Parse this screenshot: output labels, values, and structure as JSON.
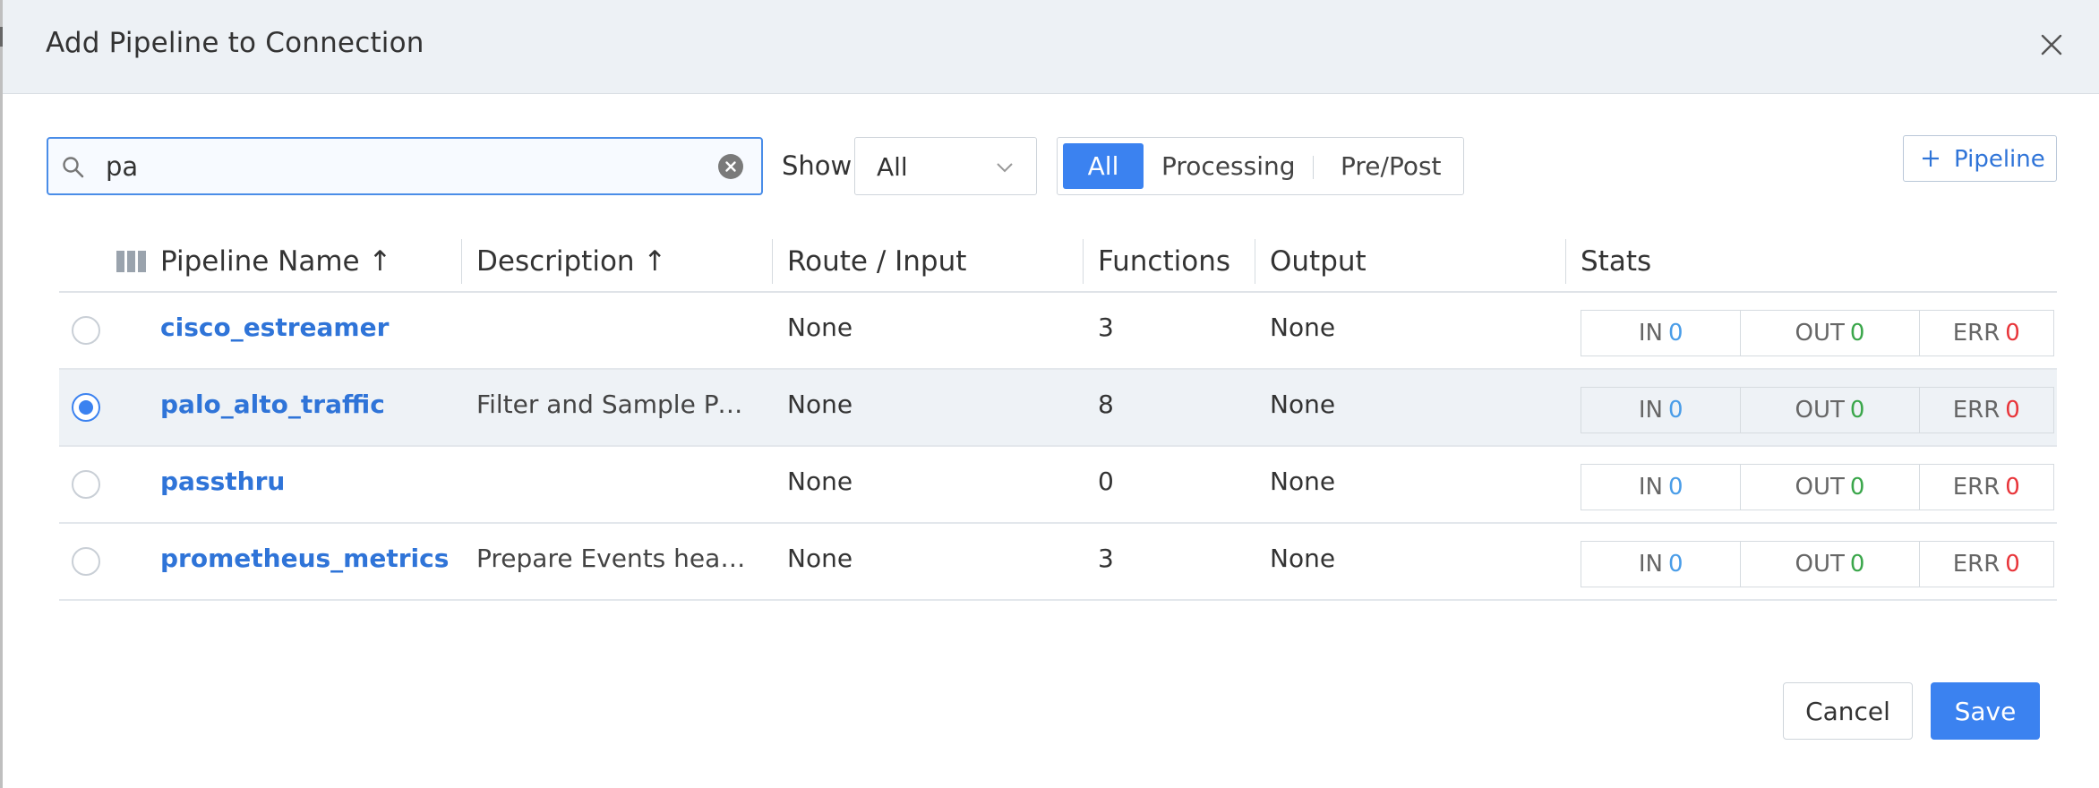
{
  "dialog": {
    "title": "Add Pipeline to Connection",
    "close_icon": "close-icon"
  },
  "toolbar": {
    "search_value": "pa",
    "search_icon": "search-icon",
    "clear_icon": "clear-circle-icon",
    "show_label": "Show",
    "show_selected": "All",
    "filter_options": [
      "All",
      "Processing",
      "Pre/Post"
    ],
    "filter_active": "All",
    "add_pipeline_label": "Pipeline"
  },
  "table": {
    "columns": [
      "Pipeline Name ↑",
      "Description ↑",
      "Route / Input",
      "Functions",
      "Output",
      "Stats"
    ],
    "rows": [
      {
        "name": "cisco_estreamer",
        "description": "",
        "route": "None",
        "functions": "3",
        "output": "None",
        "selected": false,
        "stats": {
          "in_label": "IN",
          "in": "0",
          "out_label": "OUT",
          "out": "0",
          "err_label": "ERR",
          "err": "0"
        }
      },
      {
        "name": "palo_alto_traffic",
        "description": "Filter and Sample Palo ...",
        "route": "None",
        "functions": "8",
        "output": "None",
        "selected": true,
        "stats": {
          "in_label": "IN",
          "in": "0",
          "out_label": "OUT",
          "out": "0",
          "err_label": "ERR",
          "err": "0"
        }
      },
      {
        "name": "passthru",
        "description": "",
        "route": "None",
        "functions": "0",
        "output": "None",
        "selected": false,
        "stats": {
          "in_label": "IN",
          "in": "0",
          "out_label": "OUT",
          "out": "0",
          "err_label": "ERR",
          "err": "0"
        }
      },
      {
        "name": "prometheus_metrics",
        "description": "Prepare Events headed ...",
        "route": "None",
        "functions": "3",
        "output": "None",
        "selected": false,
        "stats": {
          "in_label": "IN",
          "in": "0",
          "out_label": "OUT",
          "out": "0",
          "err_label": "ERR",
          "err": "0"
        }
      }
    ]
  },
  "footer": {
    "cancel_label": "Cancel",
    "save_label": "Save"
  },
  "colors": {
    "accent": "#3b82f0",
    "link": "#2f74d8",
    "in": "#4a9de8",
    "out": "#3aa64a",
    "err": "#e8353a",
    "header_bg": "#edf1f5"
  }
}
